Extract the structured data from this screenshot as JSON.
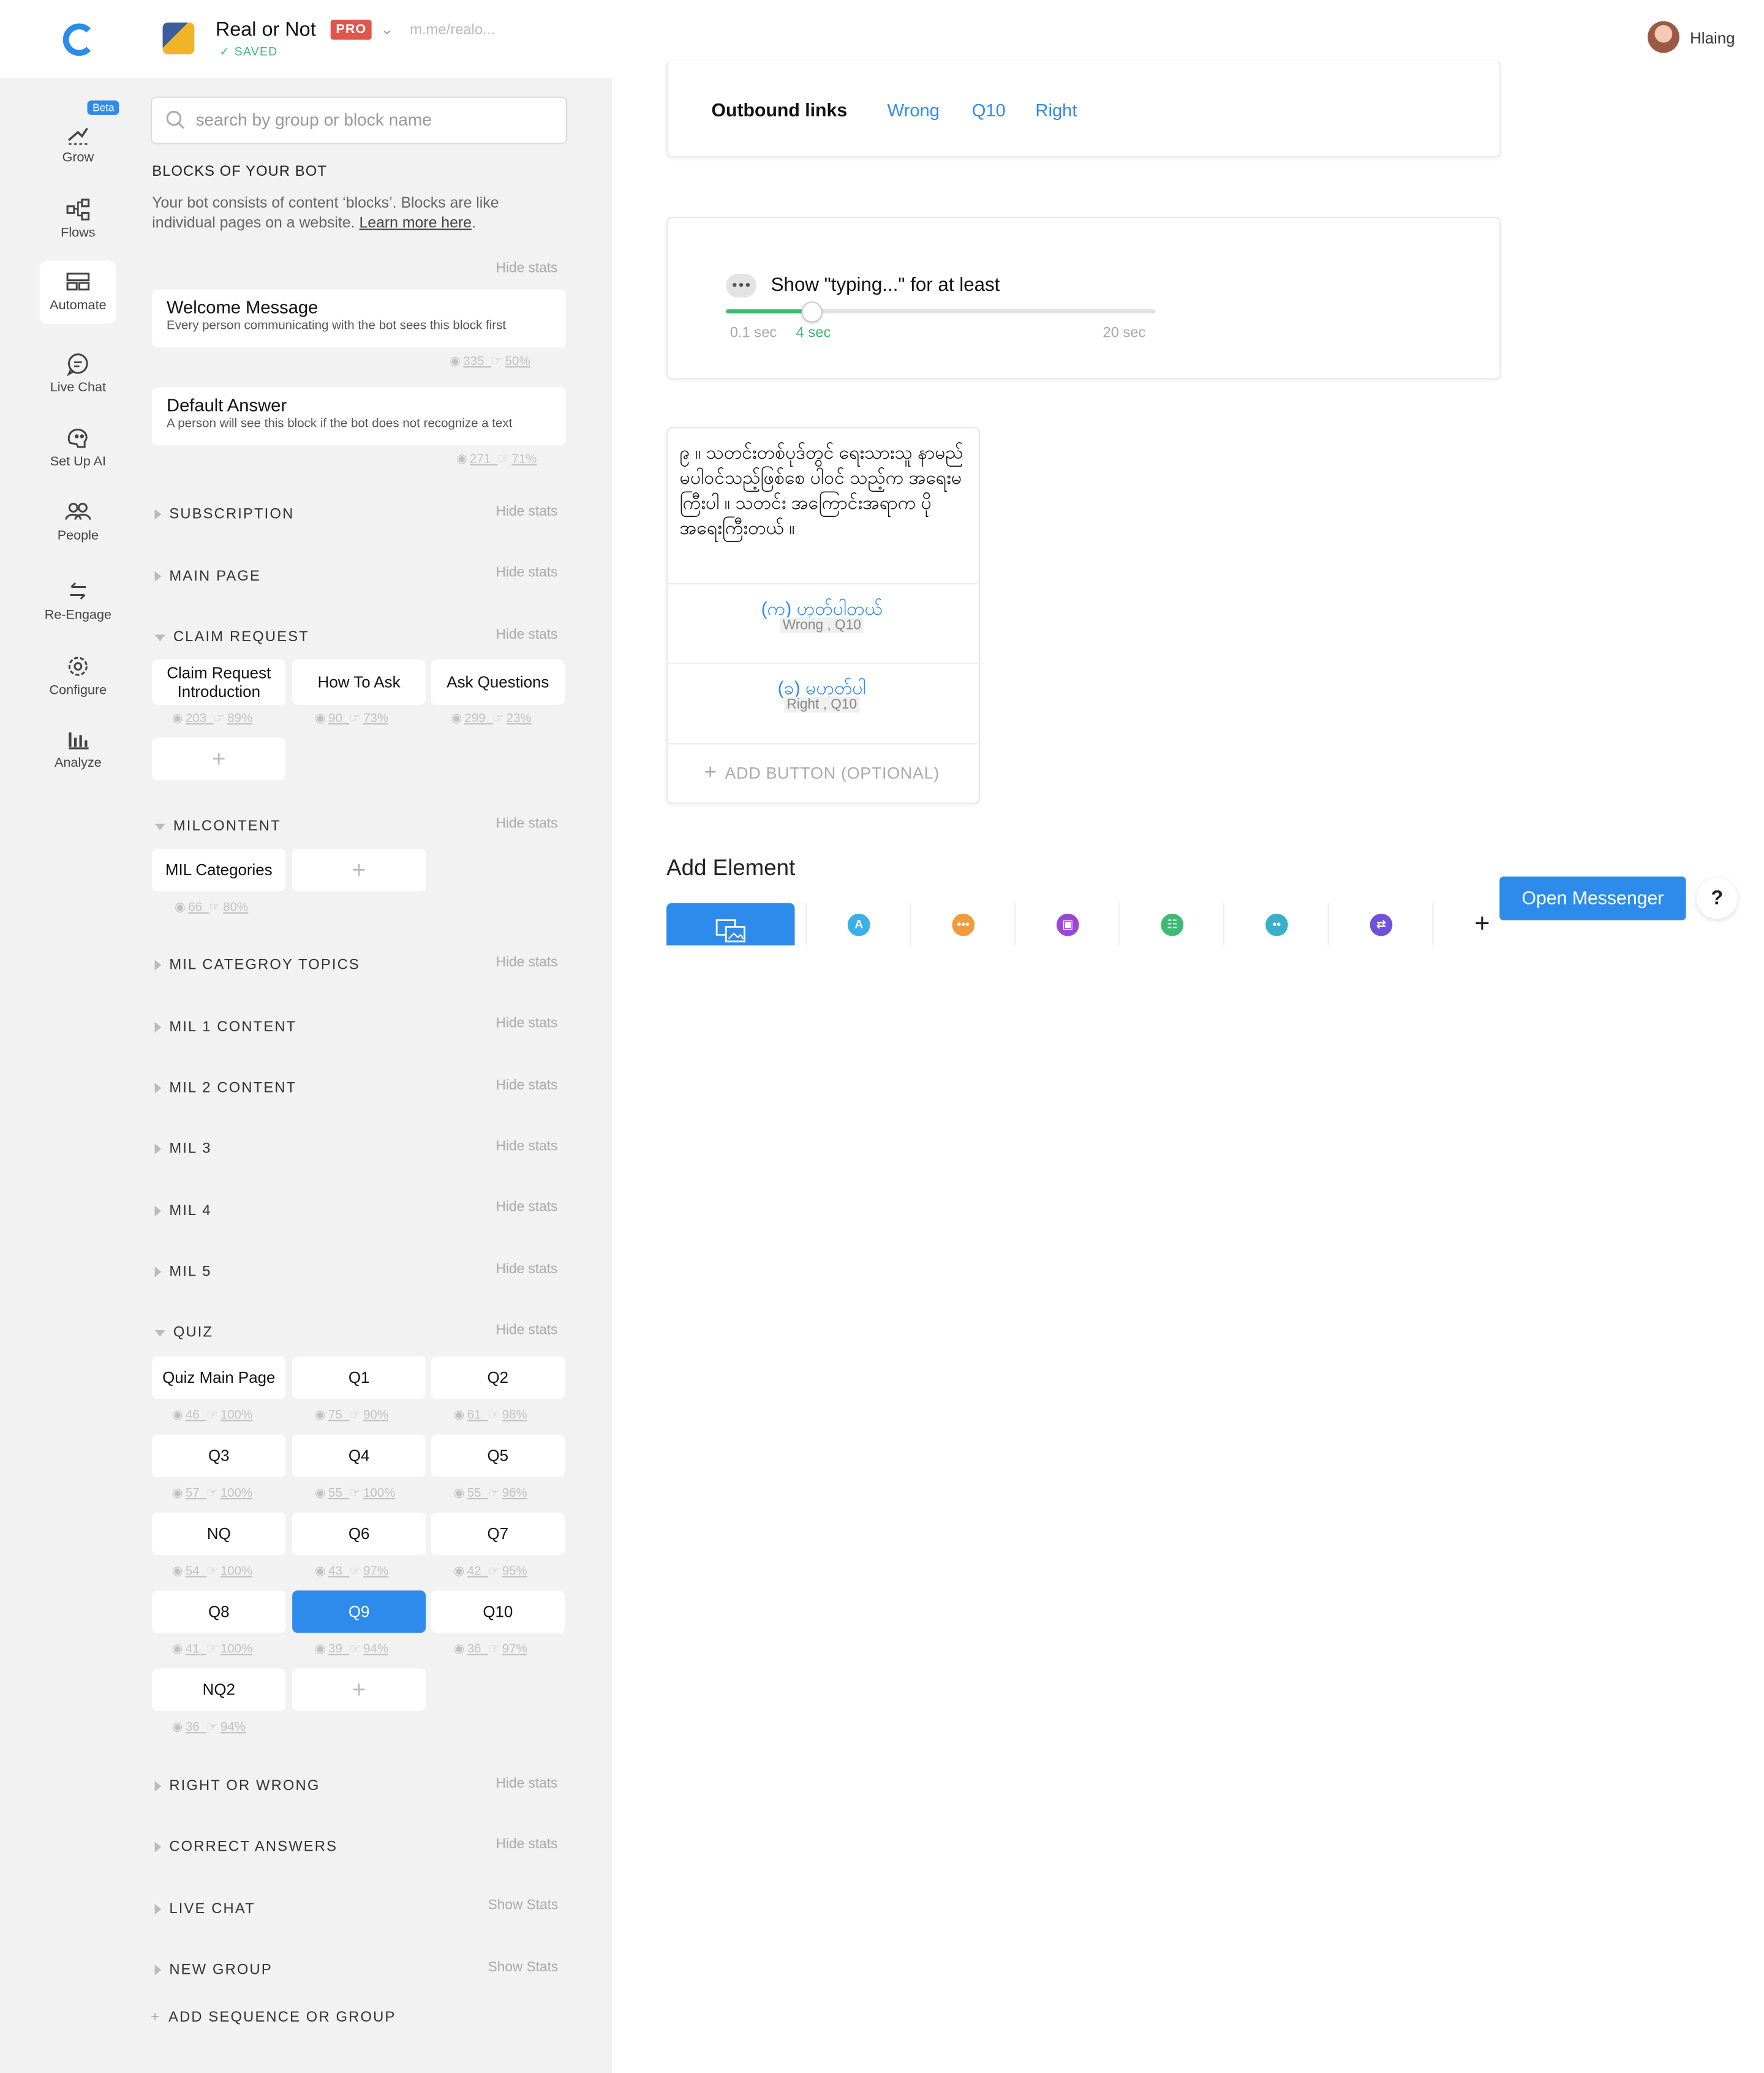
{
  "header": {
    "bot_name": "Real or Not",
    "pro_badge": "PRO",
    "saved_label": "SAVED",
    "bot_link": "m.me/realo...",
    "user_name": "Hlaing"
  },
  "nav": {
    "items": [
      {
        "label": "Grow",
        "icon": "grow-icon"
      },
      {
        "label": "Flows",
        "icon": "flows-icon"
      },
      {
        "label": "Automate",
        "icon": "automate-icon"
      },
      {
        "label": "Live Chat",
        "icon": "live-chat-icon"
      },
      {
        "label": "Set Up AI",
        "icon": "ai-icon"
      },
      {
        "label": "People",
        "icon": "people-icon"
      },
      {
        "label": "Re-Engage",
        "icon": "re-engage-icon"
      },
      {
        "label": "Configure",
        "icon": "gear-icon"
      },
      {
        "label": "Analyze",
        "icon": "analyze-icon"
      }
    ],
    "beta_badge": "Beta",
    "active": "Automate"
  },
  "blocks_panel": {
    "search_placeholder": "search by group or block name",
    "title": "BLOCKS OF YOUR BOT",
    "desc": "Your bot consists of content ‘blocks’. Blocks are like individual pages on a website.",
    "learn_more": "Learn more here",
    "hide_stats": "Hide stats",
    "show_stats": "Show Stats",
    "welcome": {
      "title": "Welcome Message",
      "desc": "Every person communicating with the bot sees this block first",
      "views": "335",
      "ctr": "50%"
    },
    "default": {
      "title": "Default Answer",
      "desc": "A person will see this block if the bot does not recognize a text",
      "views": "271",
      "ctr": "71%"
    },
    "groups": {
      "subscription": "SUBSCRIPTION",
      "main_page": "MAIN PAGE",
      "claim_request": "CLAIM REQUEST",
      "milcontent": "MILCONTENT",
      "mil_category_topics": "MIL CATEGROY TOPICS",
      "mil1": "MIL 1 CONTENT",
      "mil2": "MIL 2 CONTENT",
      "mil3": "MIL 3",
      "mil4": "MIL 4",
      "mil5": "MIL 5",
      "quiz": "QUIZ",
      "right_or_wrong": "RIGHT OR WRONG",
      "correct_answers": "CORRECT ANSWERS",
      "live_chat": "LIVE CHAT",
      "new_group": "NEW GROUP"
    },
    "claim_blocks": [
      {
        "label": "Claim Request Introduction",
        "views": "203",
        "ctr": "89%"
      },
      {
        "label": "How To Ask",
        "views": "90",
        "ctr": "73%"
      },
      {
        "label": "Ask Questions",
        "views": "299",
        "ctr": "23%"
      }
    ],
    "mil_blocks": [
      {
        "label": "MIL Categories",
        "views": "66",
        "ctr": "80%"
      }
    ],
    "quiz_blocks": [
      {
        "label": "Quiz Main Page",
        "views": "46",
        "ctr": "100%"
      },
      {
        "label": "Q1",
        "views": "75",
        "ctr": "90%"
      },
      {
        "label": "Q2",
        "views": "61",
        "ctr": "98%"
      },
      {
        "label": "Q3",
        "views": "57",
        "ctr": "100%"
      },
      {
        "label": "Q4",
        "views": "55",
        "ctr": "100%"
      },
      {
        "label": "Q5",
        "views": "55",
        "ctr": "96%"
      },
      {
        "label": "NQ",
        "views": "54",
        "ctr": "100%"
      },
      {
        "label": "Q6",
        "views": "43",
        "ctr": "97%"
      },
      {
        "label": "Q7",
        "views": "42",
        "ctr": "95%"
      },
      {
        "label": "Q8",
        "views": "41",
        "ctr": "100%"
      },
      {
        "label": "Q9",
        "views": "39",
        "ctr": "94%"
      },
      {
        "label": "Q10",
        "views": "36",
        "ctr": "97%"
      },
      {
        "label": "NQ2",
        "views": "36",
        "ctr": "94%"
      }
    ],
    "add_sequence": "ADD SEQUENCE OR GROUP"
  },
  "editor": {
    "outbound_label": "Outbound links",
    "outbound_links": [
      "Wrong",
      "Q10",
      "Right"
    ],
    "typing": {
      "title": "Show \"typing...\" for at least",
      "min": "0.1 sec",
      "current": "4 sec",
      "max": "20 sec",
      "value_sec": 4,
      "min_sec": 0.1,
      "max_sec": 20
    },
    "message": "၉ ။ သတင်းတစ်ပုဒ်တွင် ရေးသားသူ နာမည် မပါဝင်သည့်ဖြစ်စေ ပါဝင် သည့်က အရေးမကြီးပါ ။ သတင်း အကြောင်းအရာက ပိုအရေးကြီးတယ် ။",
    "buttons": [
      {
        "label": "(က) ဟုတ်ပါတယ်",
        "targets": "Wrong , Q10"
      },
      {
        "label": "(ခ) မဟုတ်ပါ",
        "targets": "Right , Q10"
      }
    ],
    "add_button": "ADD BUTTON (OPTIONAL)",
    "add_element_title": "Add Element",
    "element_tabs": [
      {
        "icon": "gallery-icon",
        "color": "#2d8ceb"
      },
      {
        "icon": "text-icon",
        "color": "#3ab0e8"
      },
      {
        "icon": "typing-icon",
        "color": "#f29b3c"
      },
      {
        "icon": "image-icon",
        "color": "#9b46d6"
      },
      {
        "icon": "list-icon",
        "color": "#3dba74"
      },
      {
        "icon": "quick-reply-icon",
        "color": "#3ab0c8"
      },
      {
        "icon": "jump-icon",
        "color": "#6f52d9"
      },
      {
        "icon": "plus-icon",
        "color": "#222222"
      }
    ],
    "open_messenger": "Open Messenger",
    "help": "?"
  }
}
